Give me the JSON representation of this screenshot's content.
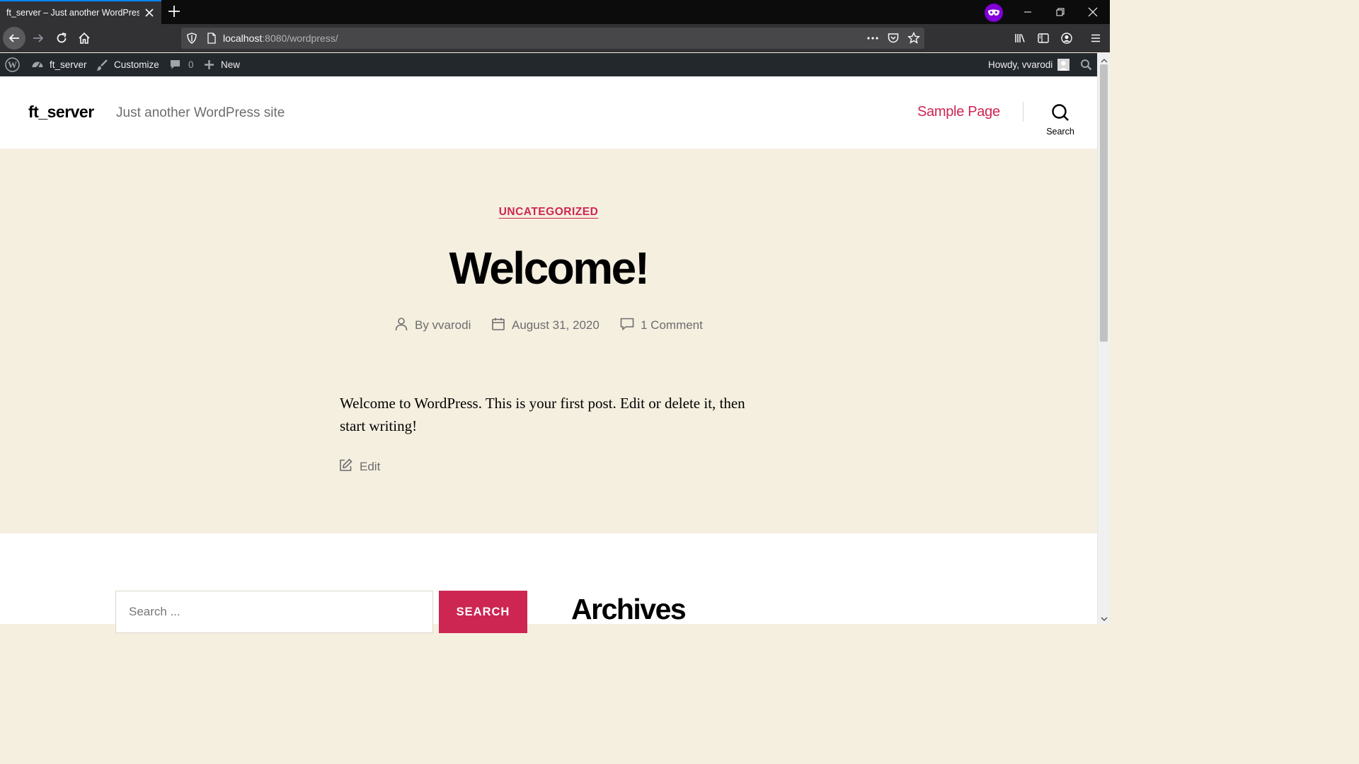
{
  "browser": {
    "tab_title": "ft_server – Just another WordPress site",
    "url_host": "localhost",
    "url_path": ":8080/wordpress/",
    "private_color": "#8000d7",
    "accent_color": "#0a84ff"
  },
  "adminbar": {
    "site_name": "ft_server",
    "customize_label": "Customize",
    "comment_count": "0",
    "new_label": "New",
    "howdy_label": "Howdy, vvarodi"
  },
  "header": {
    "site_title": "ft_server",
    "site_description": "Just another WordPress site",
    "nav_item": "Sample Page",
    "search_label": "Search"
  },
  "post": {
    "category": "UNCATEGORIZED",
    "title": "Welcome!",
    "author": "By vvarodi",
    "date": "August 31, 2020",
    "comments": "1 Comment",
    "body": "Welcome to WordPress. This is your first post. Edit or delete it, then start writing!",
    "edit_label": "Edit"
  },
  "widgets": {
    "search_placeholder": "Search ...",
    "search_button": "SEARCH",
    "archives_title": "Archives"
  },
  "colors": {
    "accent": "#cd2653",
    "hero_bg": "#f5efe0",
    "adminbar_bg": "#23282d"
  },
  "icons": [
    "close-icon",
    "plus-icon",
    "private-browsing-icon",
    "minimize-icon",
    "restore-icon",
    "back-icon",
    "forward-icon",
    "reload-icon",
    "home-icon",
    "shield-icon",
    "page-icon",
    "more-icon",
    "pocket-icon",
    "star-icon",
    "library-icon",
    "sidebar-icon",
    "account-icon",
    "menu-icon",
    "wordpress-icon",
    "dashboard-icon",
    "brush-icon",
    "comment-icon",
    "user-icon",
    "calendar-icon",
    "edit-icon",
    "search-icon"
  ]
}
